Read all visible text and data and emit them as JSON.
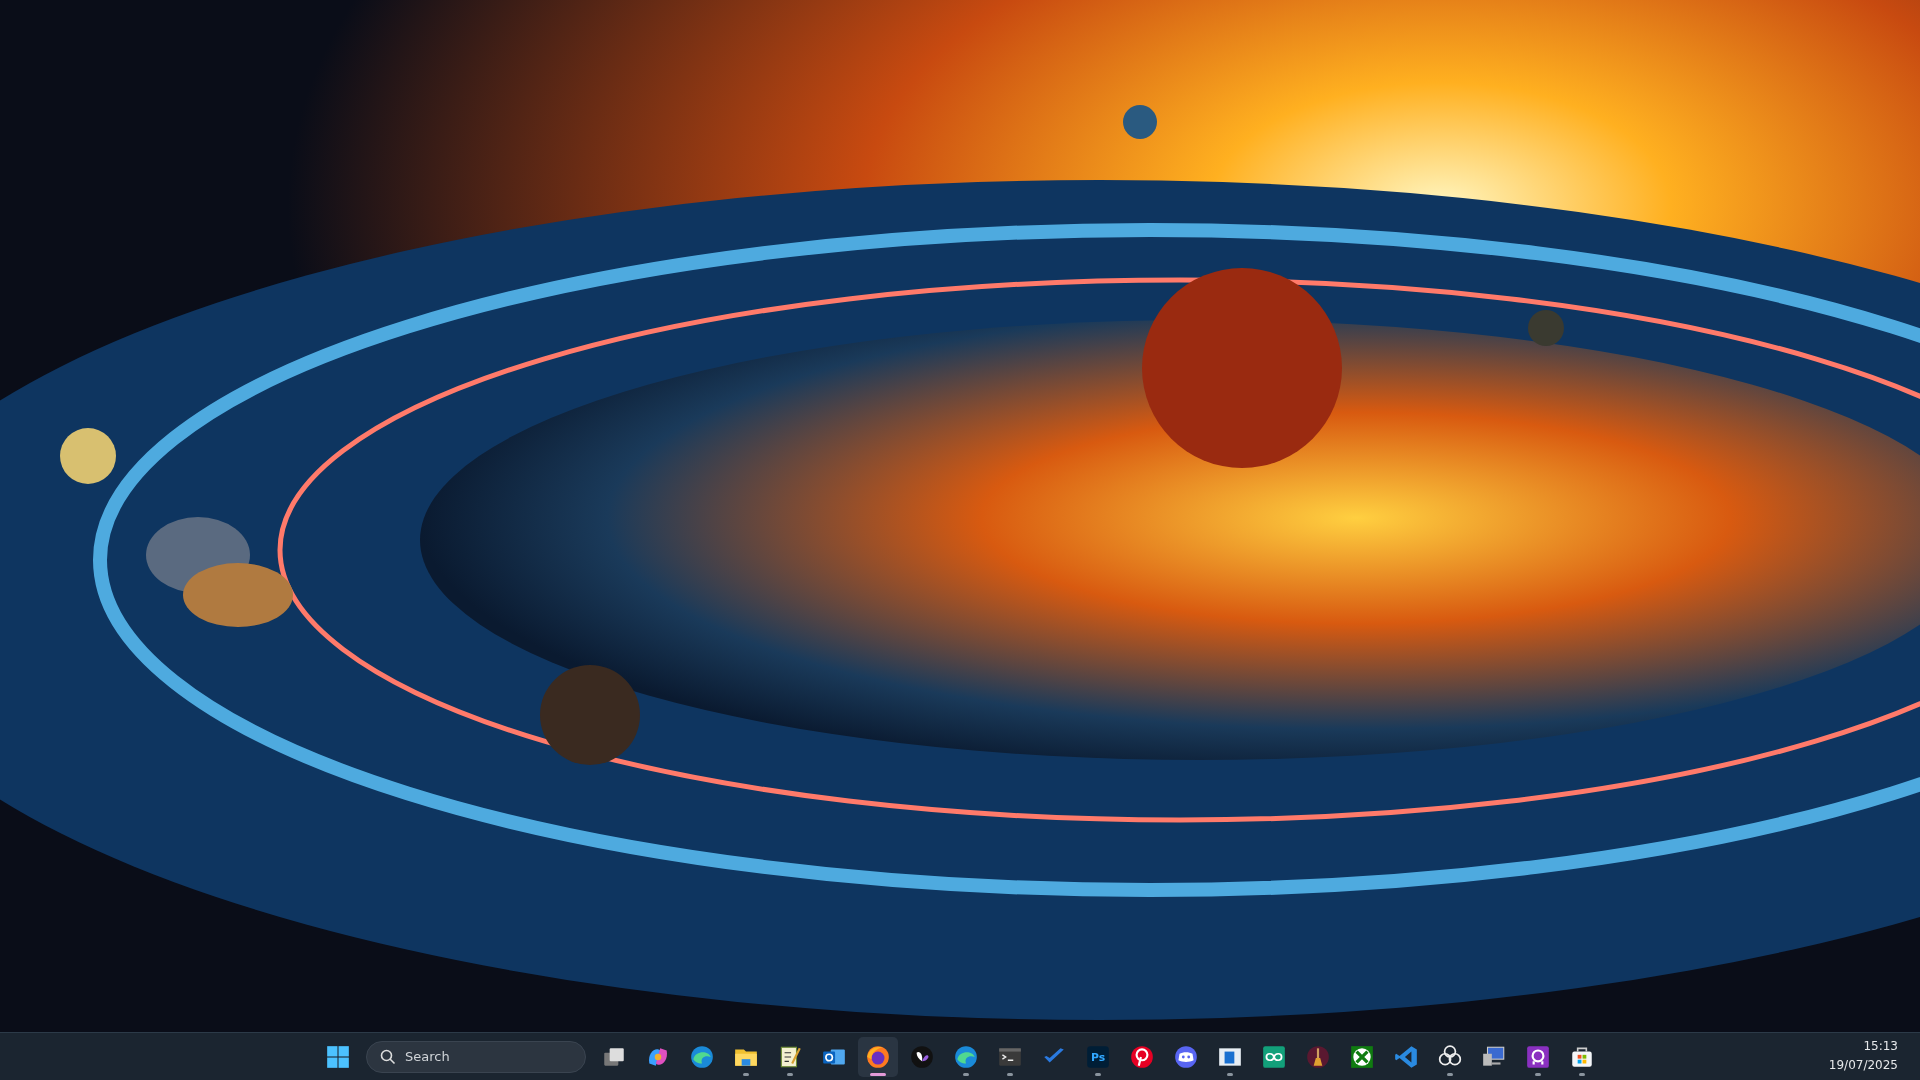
{
  "taskbar": {
    "search": {
      "placeholder": "Search"
    },
    "apps": [
      {
        "kind": "task-view",
        "running": false,
        "selected": false
      },
      {
        "kind": "swirl-logo",
        "running": false,
        "selected": false
      },
      {
        "kind": "globe-swirl",
        "running": false,
        "selected": false
      },
      {
        "kind": "folder",
        "running": true,
        "selected": false
      },
      {
        "kind": "notepad",
        "running": true,
        "selected": false
      },
      {
        "kind": "mail",
        "running": false,
        "selected": false
      },
      {
        "kind": "fox-globe",
        "running": true,
        "selected": true
      },
      {
        "kind": "heart-logo",
        "running": false,
        "selected": false
      },
      {
        "kind": "globe-swirl",
        "running": true,
        "selected": false
      },
      {
        "kind": "terminal",
        "running": true,
        "selected": false
      },
      {
        "kind": "checkmark",
        "running": false,
        "selected": false
      },
      {
        "kind": "text-tile",
        "text": "Ps",
        "running": true,
        "selected": false
      },
      {
        "kind": "pin-logo",
        "running": false,
        "selected": false
      },
      {
        "kind": "controller",
        "running": false,
        "selected": false
      },
      {
        "kind": "window",
        "running": true,
        "selected": false
      },
      {
        "kind": "infinity",
        "running": false,
        "selected": false
      },
      {
        "kind": "broom",
        "running": false,
        "selected": false
      },
      {
        "kind": "x-logo",
        "running": false,
        "selected": false
      },
      {
        "kind": "code",
        "running": false,
        "selected": false
      },
      {
        "kind": "knot",
        "running": true,
        "selected": false
      },
      {
        "kind": "monitor",
        "running": false,
        "selected": false
      },
      {
        "kind": "person-logo",
        "running": true,
        "selected": false
      },
      {
        "kind": "shopping-bag",
        "running": true,
        "selected": false
      }
    ],
    "clock": {
      "time": "15:13",
      "date": "19/07/2025"
    }
  }
}
